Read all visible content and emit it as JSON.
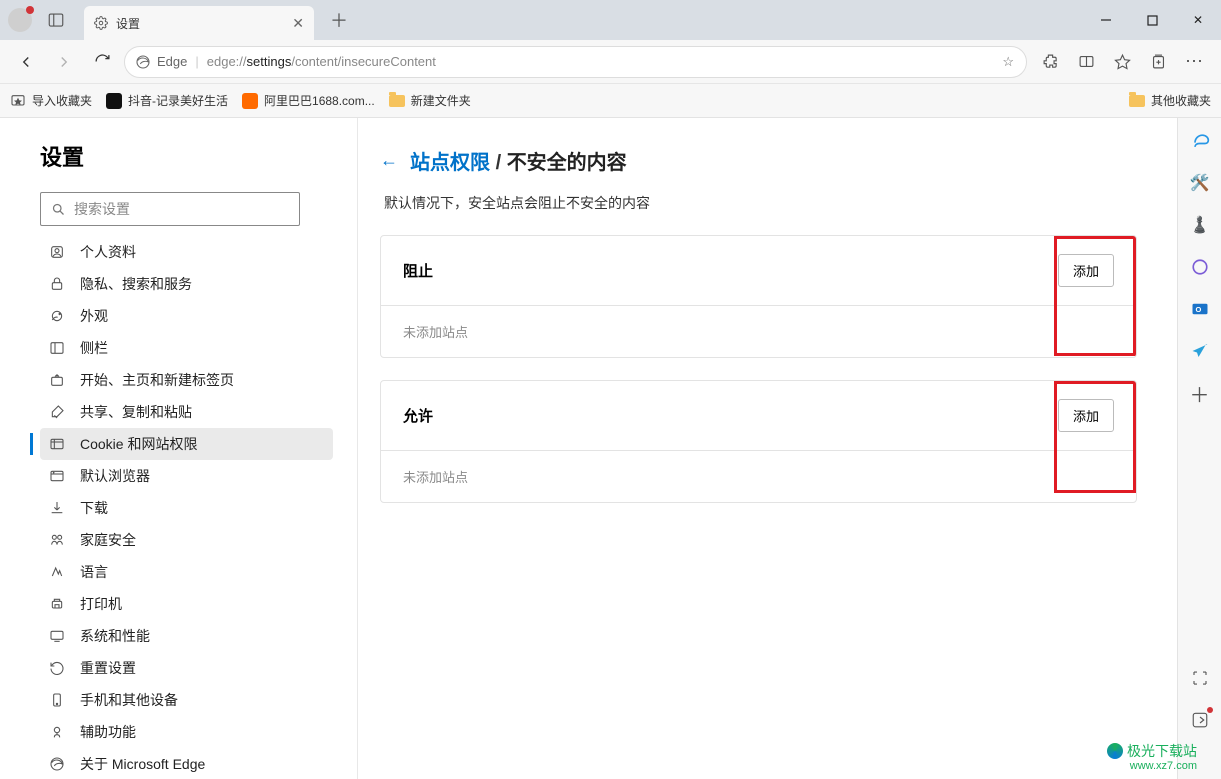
{
  "window": {
    "title": "设置"
  },
  "tab": {
    "title": "设置"
  },
  "address": {
    "scheme_label": "Edge",
    "url_prefix": "edge://",
    "url_path_bold": "settings",
    "url_path_rest": "/content/insecureContent"
  },
  "bookmarks": {
    "import": "导入收藏夹",
    "items": [
      {
        "label": "抖音-记录美好生活",
        "color": "#111"
      },
      {
        "label": "阿里巴巴1688.com...",
        "color": "#ff6a00"
      },
      {
        "label": "新建文件夹",
        "color": "folder"
      }
    ],
    "other": "其他收藏夹"
  },
  "sidebar": {
    "title": "设置",
    "search_placeholder": "搜索设置",
    "items": [
      {
        "label": "个人资料"
      },
      {
        "label": "隐私、搜索和服务"
      },
      {
        "label": "外观"
      },
      {
        "label": "侧栏"
      },
      {
        "label": "开始、主页和新建标签页"
      },
      {
        "label": "共享、复制和粘贴"
      },
      {
        "label": "Cookie 和网站权限",
        "active": true
      },
      {
        "label": "默认浏览器"
      },
      {
        "label": "下载"
      },
      {
        "label": "家庭安全"
      },
      {
        "label": "语言"
      },
      {
        "label": "打印机"
      },
      {
        "label": "系统和性能"
      },
      {
        "label": "重置设置"
      },
      {
        "label": "手机和其他设备"
      },
      {
        "label": "辅助功能"
      },
      {
        "label": "关于 Microsoft Edge"
      }
    ]
  },
  "page": {
    "crumb_parent": "站点权限",
    "crumb_separator": "/",
    "crumb_current": "不安全的内容",
    "description": "默认情况下，安全站点会阻止不安全的内容",
    "sections": [
      {
        "title": "阻止",
        "add_label": "添加",
        "empty": "未添加站点"
      },
      {
        "title": "允许",
        "add_label": "添加",
        "empty": "未添加站点"
      }
    ]
  },
  "watermark": {
    "line1": "极光下载站",
    "line2": "www.xz7.com"
  }
}
